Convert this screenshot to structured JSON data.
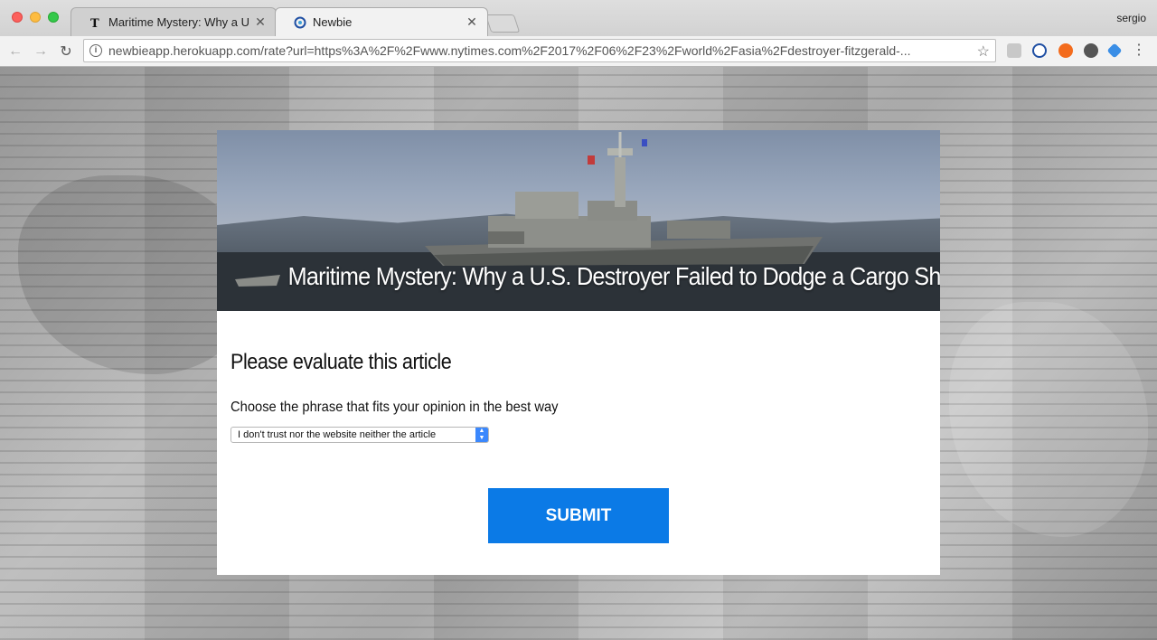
{
  "browser": {
    "tabs": [
      {
        "title": "Maritime Mystery: Why a U.S",
        "active": false,
        "favicon": "nyt-logo-icon"
      },
      {
        "title": "Newbie",
        "active": true,
        "favicon": "newbie-logo-icon"
      }
    ],
    "user": "sergio",
    "url": "newbieapp.herokuapp.com/rate?url=https%3A%2F%2Fwww.nytimes.com%2F2017%2F06%2F23%2Fworld%2Fasia%2Fdestroyer-fitzgerald-..."
  },
  "article": {
    "title": "Maritime Mystery: Why a U.S. Destroyer Failed to Dodge a Cargo Ship"
  },
  "form": {
    "heading": "Please evaluate this article",
    "label": "Choose the phrase that fits your opinion in the best way",
    "selected_option": "I don't trust nor the website neither the article",
    "submit_label": "SUBMIT"
  },
  "colors": {
    "submit_bg": "#0b7ae6",
    "select_arrow_bg": "#3b88fd"
  }
}
